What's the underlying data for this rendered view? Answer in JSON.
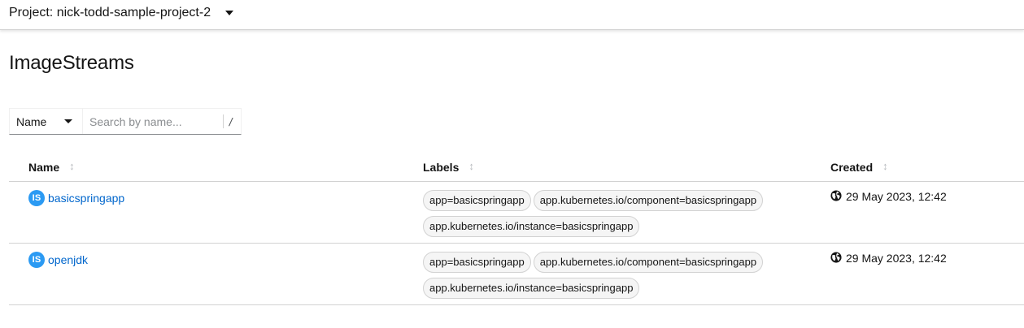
{
  "header": {
    "project_label": "Project: nick-todd-sample-project-2"
  },
  "page": {
    "title": "ImageStreams"
  },
  "filter": {
    "selected": "Name",
    "placeholder": "Search by name...",
    "shortcut": "/"
  },
  "table": {
    "columns": [
      {
        "label": "Name"
      },
      {
        "label": "Labels"
      },
      {
        "label": "Created"
      }
    ],
    "rows": [
      {
        "badge": "IS",
        "name": "basicspringapp",
        "labels": [
          "app=basicspringapp",
          "app.kubernetes.io/component=basicspringapp",
          "app.kubernetes.io/instance=basicspringapp"
        ],
        "created": "29 May 2023, 12:42"
      },
      {
        "badge": "IS",
        "name": "openjdk",
        "labels": [
          "app=basicspringapp",
          "app.kubernetes.io/component=basicspringapp",
          "app.kubernetes.io/instance=basicspringapp"
        ],
        "created": "29 May 2023, 12:42"
      }
    ]
  },
  "icons": {
    "project_dropdown": "caret-down-icon",
    "filter_dropdown": "caret-down-icon",
    "sort": "sort-icon",
    "created": "globe-icon"
  },
  "colors": {
    "link": "#0066cc",
    "badge": "#2b9af3",
    "border": "#d2d2d2"
  }
}
